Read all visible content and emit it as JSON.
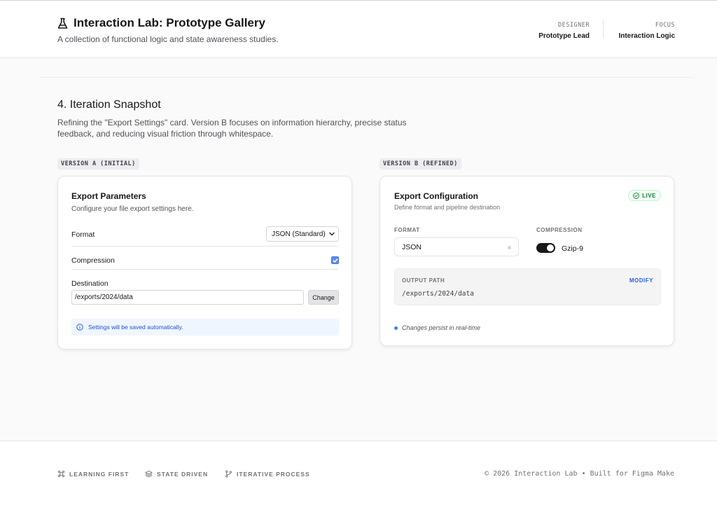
{
  "header": {
    "title": "Interaction Lab: Prototype Gallery",
    "subtitle": "A collection of functional logic and state awareness studies.",
    "icon": "flask-icon",
    "designer": {
      "label": "DESIGNER",
      "value": "Prototype Lead"
    },
    "focus": {
      "label": "FOCUS",
      "value": "Interaction Logic"
    }
  },
  "section": {
    "title": "4. Iteration Snapshot",
    "description": "Refining the \"Export Settings\" card. Version B focuses on information hierarchy, precise status feedback, and reducing visual friction through whitespace."
  },
  "version_a": {
    "tag": "VERSION A (INITIAL)",
    "title": "Export Parameters",
    "subtitle": "Configure your file export settings here.",
    "format_label": "Format",
    "format_value": "JSON (Standard)",
    "compression_label": "Compression",
    "compression_checked": true,
    "destination_label": "Destination",
    "destination_value": "/exports/2024/data",
    "change_label": "Change",
    "notice": "Settings will be saved automatically."
  },
  "version_b": {
    "tag": "VERSION B (REFINED)",
    "title": "Export Configuration",
    "subtitle": "Define format and pipeline destination",
    "live_label": "LIVE",
    "format_label": "FORMAT",
    "format_value": "JSON",
    "compression_label": "COMPRESSION",
    "compression_value": "Gzip-9",
    "compression_on": true,
    "output_label": "OUTPUT PATH",
    "modify_label": "MODIFY",
    "output_path": "/exports/2024/data",
    "status": "Changes persist in real-time"
  },
  "footer": {
    "items": [
      {
        "icon": "command-icon",
        "label": "LEARNING FIRST"
      },
      {
        "icon": "layers-icon",
        "label": "STATE DRIVEN"
      },
      {
        "icon": "git-branch-icon",
        "label": "ITERATIVE PROCESS"
      }
    ],
    "copyright": "© 2026 Interaction Lab • Built for Figma Make"
  },
  "colors": {
    "accent": "#2563eb",
    "live_green": "#15803d",
    "status_dot": "#3b82f6",
    "checkbox": "#5b8def"
  }
}
